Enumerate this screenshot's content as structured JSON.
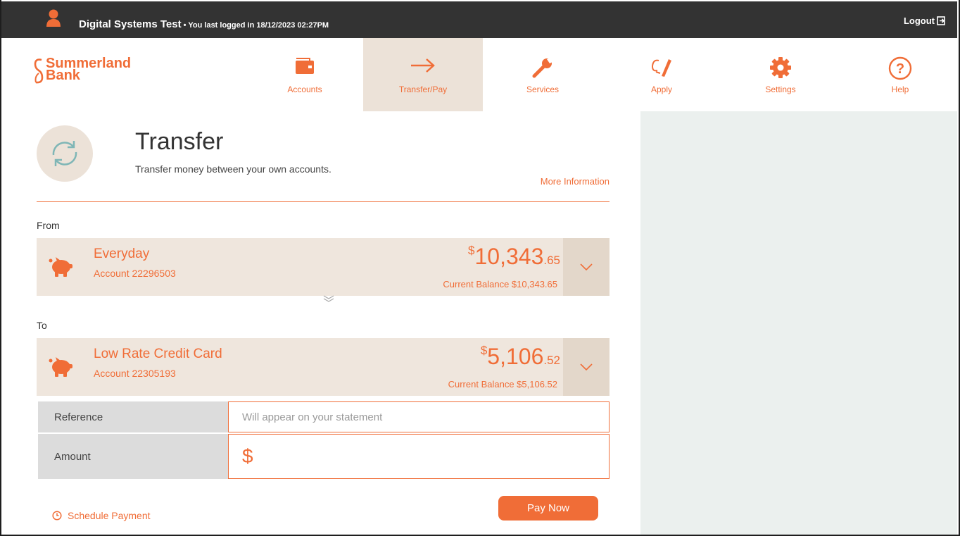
{
  "topbar": {
    "user_name": "Digital Systems Test",
    "last_login": " • You last logged in 18/12/2023 02:27PM",
    "logout_label": "Logout"
  },
  "brand": {
    "name_line1": "Summerland",
    "name_line2": "Bank",
    "accent_color": "#f06d37"
  },
  "nav": {
    "items": [
      {
        "label": "Accounts",
        "icon": "wallet-icon"
      },
      {
        "label": "Transfer/Pay",
        "icon": "arrow-right-icon",
        "active": true
      },
      {
        "label": "Services",
        "icon": "wrench-icon"
      },
      {
        "label": "Apply",
        "icon": "pen-sign-icon"
      },
      {
        "label": "Settings",
        "icon": "gear-icon"
      },
      {
        "label": "Help",
        "icon": "question-circle-icon"
      }
    ]
  },
  "page": {
    "title": "Transfer",
    "subtitle": "Transfer money between your own accounts.",
    "more_info": "More Information"
  },
  "from": {
    "label": "From",
    "account_name": "Everyday",
    "account_number": "Account 22296503",
    "currency_symbol": "$",
    "balance_main": "10,343",
    "balance_cents": ".65",
    "current_balance": "Current Balance $10,343.65"
  },
  "to": {
    "label": "To",
    "account_name": "Low Rate Credit Card",
    "account_number": "Account 22305193",
    "currency_symbol": "$",
    "balance_main": "5,106",
    "balance_cents": ".52",
    "current_balance": "Current Balance $5,106.52"
  },
  "form": {
    "reference_label": "Reference",
    "reference_placeholder": "Will appear on your statement",
    "reference_value": "",
    "amount_label": "Amount",
    "amount_symbol": "$",
    "amount_value": ""
  },
  "actions": {
    "schedule_label": "Schedule Payment",
    "pay_now_label": "Pay Now"
  }
}
